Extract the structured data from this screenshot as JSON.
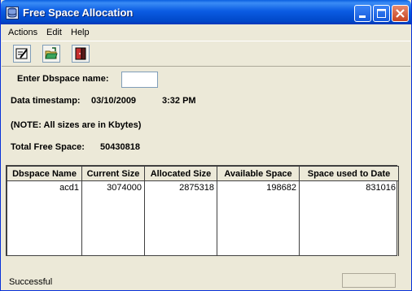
{
  "window": {
    "title": "Free Space Allocation"
  },
  "menu": {
    "items": [
      "Actions",
      "Edit",
      "Help"
    ]
  },
  "icons": {
    "app": "app-database-icon",
    "edit": "edit-pencil-icon",
    "open": "open-folder-icon",
    "exit": "exit-door-icon"
  },
  "form": {
    "dbspace_label": "Enter Dbspace name:",
    "dbspace_value": "",
    "timestamp_label": "Data timestamp:",
    "timestamp_date": "03/10/2009",
    "timestamp_time": "3:32 PM",
    "note": "(NOTE: All sizes are in Kbytes)",
    "total_label": "Total Free Space:",
    "total_value": "50430818"
  },
  "table": {
    "columns": [
      "Dbspace Name",
      "Current Size",
      "Allocated Size",
      "Available Space",
      "Space used to Date"
    ],
    "rows": [
      [
        "acd1",
        "3074000",
        "2875318",
        "198682",
        "831016"
      ]
    ]
  },
  "status": {
    "text": "Successful"
  },
  "colors": {
    "titlebar": "#0b5ce3",
    "window_bg": "#ece9d8",
    "close_button": "#c8431f"
  }
}
